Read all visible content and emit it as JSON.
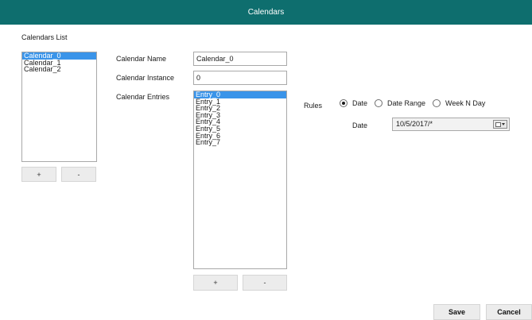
{
  "window": {
    "title": "Calendars"
  },
  "calendars_list": {
    "label": "Calendars List",
    "items": [
      {
        "label": "Calendar_0",
        "selected": true
      },
      {
        "label": "Calendar_1",
        "selected": false
      },
      {
        "label": "Calendar_2",
        "selected": false
      }
    ],
    "add_label": "+",
    "remove_label": "-"
  },
  "form": {
    "name_label": "Calendar Name",
    "name_value": "Calendar_0",
    "instance_label": "Calendar Instance",
    "instance_value": "0",
    "entries_label": "Calendar Entries"
  },
  "entries": {
    "items": [
      {
        "label": "Entry_0",
        "selected": true
      },
      {
        "label": "Entry_1",
        "selected": false
      },
      {
        "label": "Entry_2",
        "selected": false
      },
      {
        "label": "Entry_3",
        "selected": false
      },
      {
        "label": "Entry_4",
        "selected": false
      },
      {
        "label": "Entry_5",
        "selected": false
      },
      {
        "label": "Entry_6",
        "selected": false
      },
      {
        "label": "Entry_7",
        "selected": false
      }
    ],
    "add_label": "+",
    "remove_label": "-"
  },
  "rules": {
    "label": "Rules",
    "options": [
      {
        "label": "Date",
        "checked": true
      },
      {
        "label": "Date Range",
        "checked": false
      },
      {
        "label": "Week N Day",
        "checked": false
      }
    ],
    "date_label": "Date",
    "date_value": "10/5/2017/*"
  },
  "footer": {
    "save_label": "Save",
    "cancel_label": "Cancel"
  },
  "colors": {
    "titlebar": "#0e6e6e",
    "selection": "#3a94e9"
  }
}
